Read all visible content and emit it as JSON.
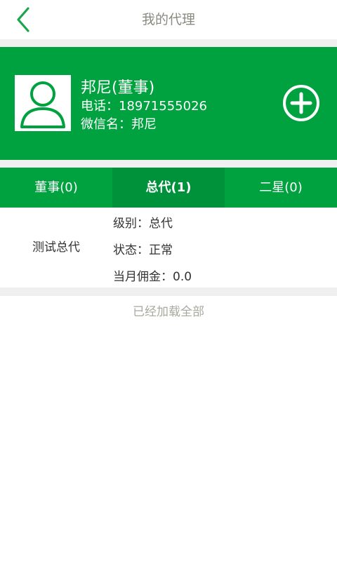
{
  "header": {
    "title": "我的代理"
  },
  "profile": {
    "name": "邦尼(董事)",
    "phone_label": "电话：",
    "phone": "18971555026",
    "wechat_label": "微信名：",
    "wechat": "邦尼"
  },
  "tabs": [
    {
      "label": "董事(0)",
      "active": false
    },
    {
      "label": "总代(1)",
      "active": true
    },
    {
      "label": "二星(0)",
      "active": false
    }
  ],
  "agents": [
    {
      "name": "测试总代",
      "level_label": "级别：",
      "level": "总代",
      "status_label": "状态：",
      "status": "正常",
      "commission_label": "当月佣金：",
      "commission": "0.0"
    }
  ],
  "footer": {
    "load_all_text": "已经加载全部"
  },
  "colors": {
    "brand_green": "#00a23f",
    "active_tab": "#00923a",
    "muted_text": "#a8a89e"
  },
  "icons": {
    "back": "chevron-left-icon",
    "avatar": "user-icon",
    "add": "plus-circle-icon"
  }
}
